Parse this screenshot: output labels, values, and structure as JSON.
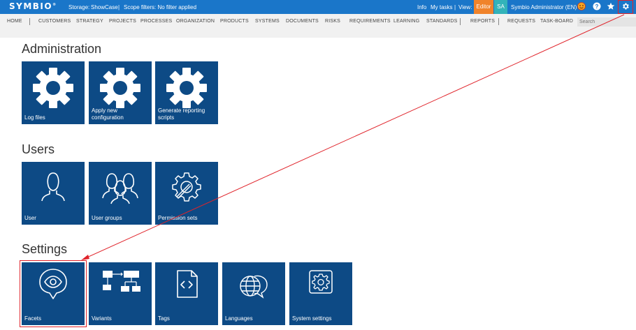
{
  "topbar": {
    "logo": "SYMBIO",
    "logo_reg": "®",
    "storage_label": "Storage:",
    "storage_value": "ShowCase",
    "separator": "|",
    "scope_label": "Scope filters: No filter applied",
    "info": "Info",
    "my_tasks": "My tasks",
    "view_label": "View:",
    "view_value": "Editor",
    "avatar_initials": "SA",
    "user_name": "Symbio Administrator (EN)"
  },
  "nav": {
    "items": [
      "HOME",
      "CUSTOMERS",
      "STRATEGY",
      "PROJECTS",
      "PROCESSES",
      "ORGANIZATION",
      "PRODUCTS",
      "SYSTEMS",
      "DOCUMENTS",
      "RISKS",
      "REQUIREMENTS",
      "LEARNING",
      "STANDARDS",
      "REPORTS",
      "REQUESTS",
      "TASK-BOARD"
    ],
    "search_placeholder": "Search"
  },
  "sections": {
    "administration": {
      "title": "Administration",
      "tiles": [
        "Log files",
        "Apply new configuration",
        "Generate reporting scripts"
      ]
    },
    "users": {
      "title": "Users",
      "tiles": [
        "User",
        "User groups",
        "Permission sets"
      ]
    },
    "settings": {
      "title": "Settings",
      "tiles": [
        "Facets",
        "Variants",
        "Tags",
        "Languages",
        "System settings"
      ]
    }
  },
  "colors": {
    "topbar": "#1a76c9",
    "tile": "#0d4a85",
    "editor_badge": "#f0832b",
    "avatar": "#33b3b9",
    "highlight": "#e0232a"
  }
}
